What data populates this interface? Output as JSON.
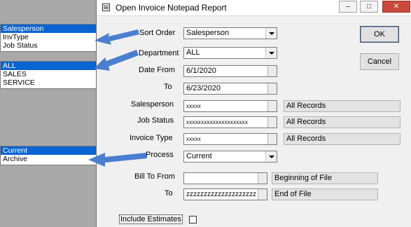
{
  "annotation_lists": {
    "sort_order_options": [
      {
        "label": "Salesperson",
        "selected": true
      },
      {
        "label": "InvType",
        "selected": false
      },
      {
        "label": "Job Status",
        "selected": false
      }
    ],
    "department_options": [
      {
        "label": "ALL",
        "selected": true
      },
      {
        "label": "SALES",
        "selected": false
      },
      {
        "label": "SERVICE",
        "selected": false
      }
    ],
    "process_options": [
      {
        "label": "Current",
        "selected": true
      },
      {
        "label": "Archive",
        "selected": false
      }
    ]
  },
  "window": {
    "title": "Open Invoice Notepad Report",
    "controls": {
      "minimize": "–",
      "maximize": "□",
      "close": "✕"
    }
  },
  "form": {
    "sort_order": {
      "label": "Sort Order",
      "value": "Salesperson"
    },
    "department": {
      "label": "Department",
      "value": "ALL"
    },
    "date_from": {
      "label": "Date From",
      "value": "6/1/2020"
    },
    "date_to": {
      "label": "To",
      "value": "6/23/2020"
    },
    "salesperson": {
      "label": "Salesperson",
      "value": "xxxxx",
      "status": "All Records"
    },
    "job_status": {
      "label": "Job Status",
      "value": "xxxxxxxxxxxxxxxxxxxxx",
      "status": "All Records"
    },
    "invoice_type": {
      "label": "Invoice Type",
      "value": "xxxxx",
      "status": "All Records"
    },
    "process": {
      "label": "Process",
      "value": "Current"
    },
    "bill_to_from": {
      "label": "Bill To From",
      "value": "",
      "status": "Beginning of File"
    },
    "bill_to_to": {
      "label": "To",
      "value": "zzzzzzzzzzzzzzzzzzzz",
      "status": "End of File"
    },
    "include_estimates": {
      "label": "Include Estimates",
      "checked": false
    }
  },
  "buttons": {
    "ok": "OK",
    "cancel": "Cancel"
  },
  "colors": {
    "arrow": "#4a7fd0",
    "selection": "#0a64d2"
  }
}
